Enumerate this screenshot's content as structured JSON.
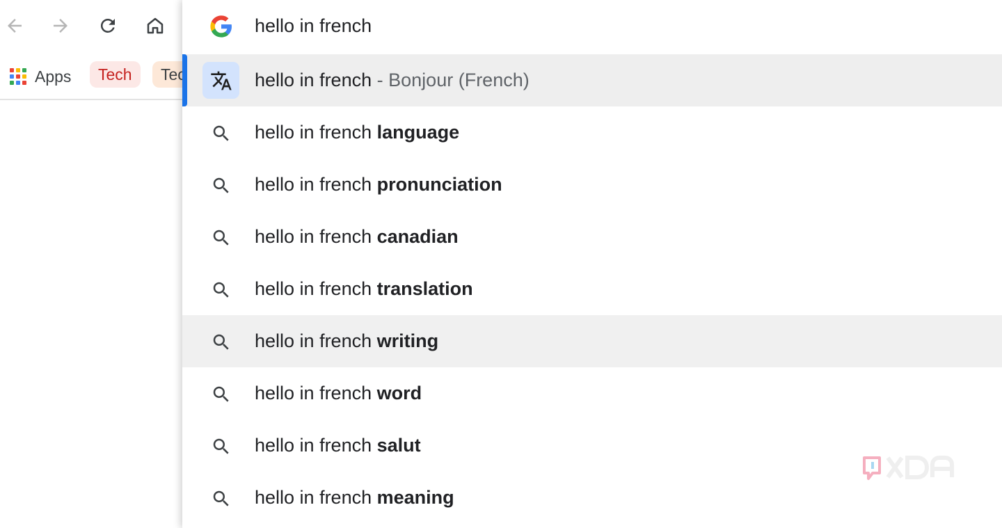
{
  "toolbar": {
    "buttons": [
      {
        "name": "back",
        "icon": "arrow-left-icon"
      },
      {
        "name": "forward",
        "icon": "arrow-right-icon"
      },
      {
        "name": "reload",
        "icon": "reload-icon"
      },
      {
        "name": "home",
        "icon": "home-icon"
      }
    ]
  },
  "bookmarks": {
    "apps_label": "Apps",
    "apps_icon": "apps-grid-icon",
    "items": [
      {
        "label": "Tech",
        "bg": "#fce8e6",
        "color": "#c5221f"
      },
      {
        "label": "Tech",
        "bg": "#fde8d8",
        "color": "#3c4043"
      }
    ]
  },
  "omnibox": {
    "query": "hello in french",
    "engine_icon": "google-g-icon",
    "answer": {
      "icon": "translate-icon",
      "base": "hello in french",
      "separator": "-",
      "value": "Bonjour (French)"
    },
    "suggestions": [
      {
        "base": "hello in french",
        "bold": "language"
      },
      {
        "base": "hello in french",
        "bold": "pronunciation"
      },
      {
        "base": "hello in french",
        "bold": "canadian"
      },
      {
        "base": "hello in french",
        "bold": "translation"
      },
      {
        "base": "hello in french",
        "bold": "writing"
      },
      {
        "base": "hello in french",
        "bold": "word"
      },
      {
        "base": "hello in french",
        "bold": "salut"
      },
      {
        "base": "hello in french",
        "bold": "meaning"
      }
    ],
    "suggestion_icon": "search-icon"
  },
  "colors": {
    "accent": "#1a73e8",
    "selected_row": "#eeeeee",
    "translate_tile": "#d3e3fd"
  },
  "watermark": {
    "logo": "xda-logo"
  }
}
